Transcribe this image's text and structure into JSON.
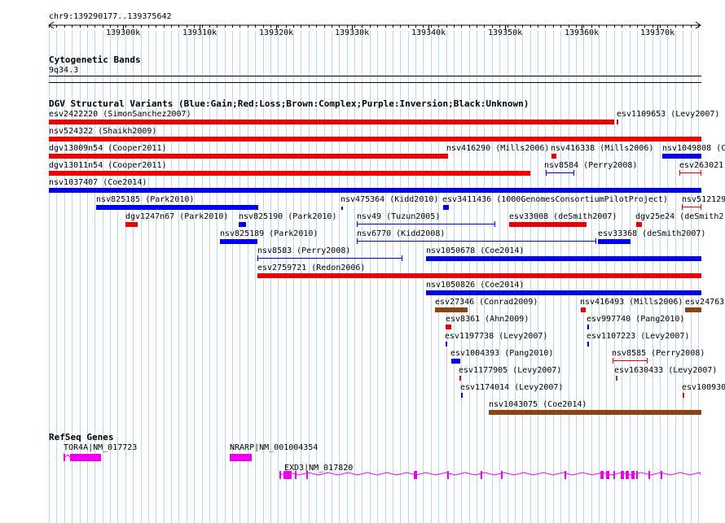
{
  "ruler": {
    "location": "chr9:139290177..139375642",
    "ticks": [
      "139300k",
      "139310k",
      "139320k",
      "139330k",
      "139340k",
      "139350k",
      "139360k",
      "139370k"
    ]
  },
  "cyto": {
    "title": "Cytogenetic Bands",
    "band": "9q34.3"
  },
  "dgv": {
    "title": "DGV Structural Variants (Blue:Gain;Red:Loss;Brown:Complex;Purple:Inversion;Black:Unknown)",
    "colors": {
      "gain": "#0000ee",
      "loss": "#ee0000",
      "complex": "#8b4513",
      "inversion": "#800080"
    },
    "labels": [
      "esv2422220 (SimonSanchez2007)",
      "esv1109653 (Levy2007)",
      "nsv524322 (Shaikh2009)",
      "dgv13009n54 (Cooper2011)",
      "nsv416290 (Mills2006)",
      "nsv416338 (Mills2006)",
      "nsv1049808 (C",
      "dgv13011n54 (Cooper2011)",
      "nsv8584 (Perry2008)",
      "esv263021",
      "nsv1037407 (Coe2014)",
      "nsv825185 (Park2010)",
      "nsv475364 (Kidd2010)",
      "esv3411436 (1000GenomesConsortiumPilotProject)",
      "nsv512129",
      "dgv1247n67 (Park2010)",
      "nsv825190 (Park2010)",
      "nsv49 (Tuzun2005)",
      "esv33008 (deSmith2007)",
      "dgv25e24 (deSmith2",
      "nsv825189 (Park2010)",
      "nsv6770 (Kidd2008)",
      "esv33368 (deSmith2007)",
      "nsv8583 (Perry2008)",
      "nsv1050678 (Coe2014)",
      "esv2759721 (Redon2006)",
      "nsv1050826 (Coe2014)",
      "esv27346 (Conrad2009)",
      "nsv416493 (Mills2006)",
      "esv24763",
      "esv8361 (Ahn2009)",
      "esv997740 (Pang2010)",
      "esv1197738 (Levy2007)",
      "esv1107223 (Levy2007)",
      "esv1004393 (Pang2010)",
      "nsv8585 (Perry2008)",
      "esv1177905 (Levy2007)",
      "esv1630433 (Levy2007)",
      "esv1174014 (Levy2007)",
      "esv100930",
      "nsv1043075 (Coe2014)"
    ]
  },
  "refseq": {
    "title": "RefSeq Genes",
    "genes": [
      "TOR4A|NM_017723",
      "NRARP|NM_001004354",
      "EXD3|NM_017820"
    ],
    "gene_color": "#ee00ee"
  }
}
